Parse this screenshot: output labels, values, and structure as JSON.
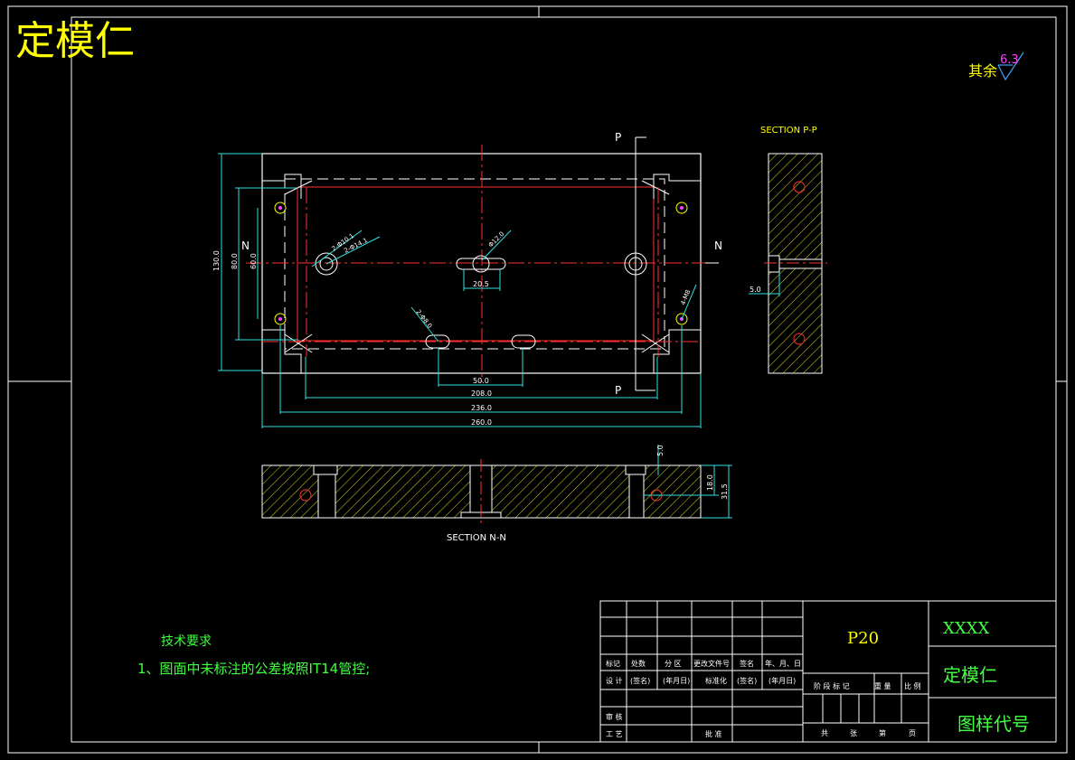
{
  "corner_title": "定模仁",
  "roughness": {
    "label": "其余",
    "value": "6.3"
  },
  "section_pp": {
    "title": "SECTION P-P",
    "dim_depth": "5.0"
  },
  "section_nn": {
    "title": "SECTION N-N",
    "dim_top": "5.0",
    "dim_mid": "18.0",
    "dim_total": "31.5"
  },
  "plan": {
    "marker_p": "P",
    "marker_n": "N",
    "dims": {
      "d130": "130.0",
      "d80": "80.0",
      "d60": "60.0",
      "d20_5": "20.5",
      "d50": "50.0",
      "d208": "208.0",
      "d236": "236.0",
      "d260": "260.0"
    },
    "callouts": {
      "hole_a": "2-Φ10.1",
      "hole_b": "2-Φ14.1",
      "hole_c": "Φ12.0",
      "hole_d": "2-Φ8.0",
      "hole_e": "4-M8"
    }
  },
  "notes": {
    "title": "技术要求",
    "line1": "1、图面中未标注的公差按照IT14管控;"
  },
  "title_block": {
    "part_no": "P20",
    "company": "XXXX",
    "drawing_name": "定模仁",
    "drawing_code": "图样代号",
    "row_labels": [
      "标记",
      "处数",
      "分 区",
      "更改文件号",
      "签名",
      "年、月、日"
    ],
    "design_row": [
      "设 计",
      "(签名)",
      "(年月日)",
      "标准化",
      "(签名)",
      "(年月日)"
    ],
    "stage_labels": [
      "阶 段 标 记",
      "重 量",
      "比 例"
    ],
    "review": "审 核",
    "process": "工 艺",
    "approve": "批 准",
    "sheet_labels": [
      "共",
      "张",
      "第",
      "页"
    ]
  }
}
